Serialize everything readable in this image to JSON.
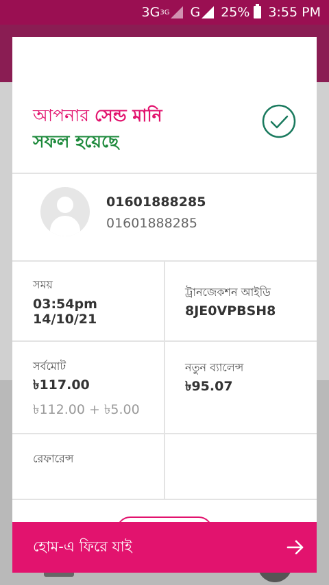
{
  "status_bar": {
    "network_3g": "3G",
    "network_3g_sup": "3G",
    "network_g": "G",
    "battery": "25%",
    "time": "3:55 PM"
  },
  "confirmation": {
    "title_part1": "আপনার ",
    "title_part2": "সেন্ড মানি",
    "title_part3": "সফল হয়েছে",
    "check_icon": "check-circle-icon"
  },
  "recipient": {
    "name": "01601888285",
    "number": "01601888285",
    "avatar_icon": "person-avatar-icon"
  },
  "details": {
    "time_label": "সময়",
    "time_value": "03:54pm",
    "date_value": "14/10/21",
    "trx_label": "ট্রানজেকশন আইডি",
    "trx_value": "8JE0VPBSH8",
    "total_label": "সর্বমোট",
    "total_value": "৳117.00",
    "total_breakdown": "৳112.00 + ৳5.00",
    "balance_label": "নতুন ব্যালেন্স",
    "balance_value": "৳95.07",
    "reference_label": "রেফারেন্স",
    "reference_value": ""
  },
  "action": {
    "home_label": "হোম-এ ফিরে যাই",
    "arrow_icon": "arrow-right-icon"
  },
  "colors": {
    "brand_pink": "#e2136e",
    "success_green": "#1e8a3c",
    "check_teal": "#1a7a5e"
  }
}
